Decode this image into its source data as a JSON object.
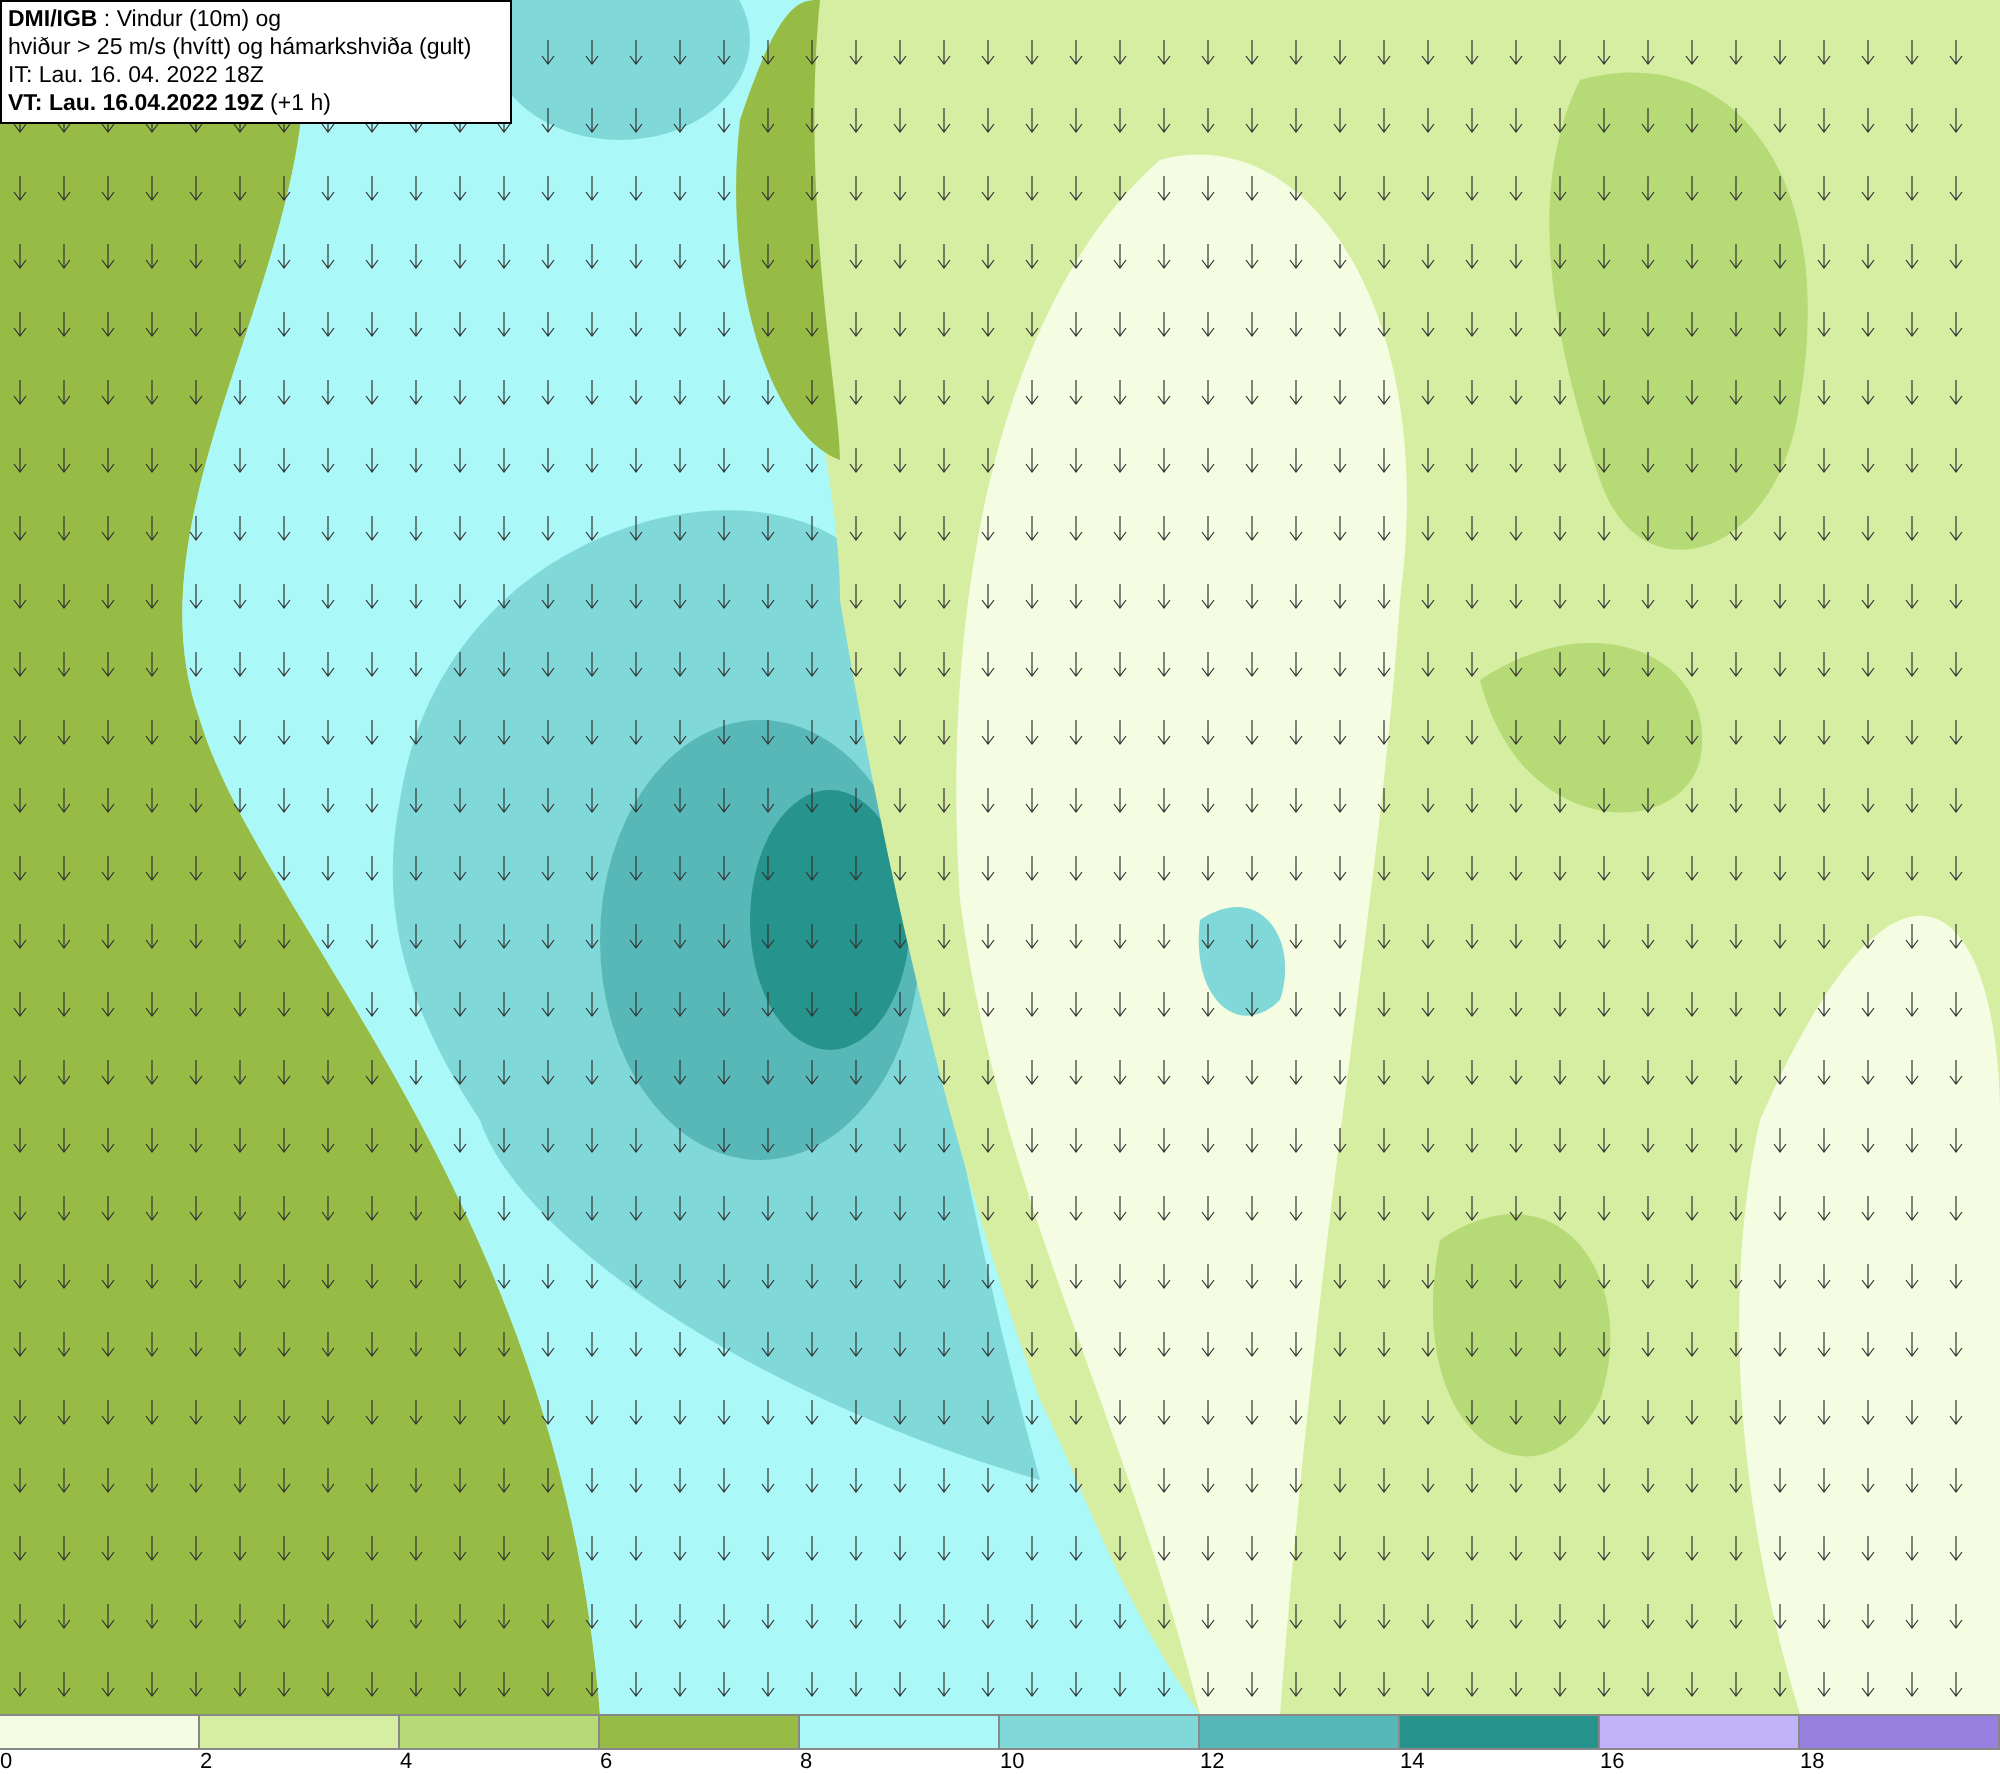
{
  "map": {
    "title_lines": [
      "**DMI/IGB** : Vindur (10m) og",
      "hviður > 25 m/s (hvítt) og hámarkshviða (gult)",
      "IT: Lau. 16. 04. 2022 18Z",
      "**VT: Lau. 16.04.2022 19Z** (+1 h)"
    ]
  },
  "legend": {
    "bins": [
      {
        "color": "#f4fde2"
      },
      {
        "color": "#d6eea2"
      },
      {
        "color": "#b6da76"
      },
      {
        "color": "#96bc46"
      },
      {
        "color": "#aaf8f8"
      },
      {
        "color": "#80d8d8"
      },
      {
        "color": "#58b8b8"
      },
      {
        "color": "#26938c"
      },
      {
        "color": "#c2b2f8"
      },
      {
        "color": "#9880e0"
      }
    ],
    "ticks": [
      "0",
      "2",
      "4",
      "6",
      "8",
      "10",
      "12",
      "14",
      "16",
      "18"
    ]
  }
}
